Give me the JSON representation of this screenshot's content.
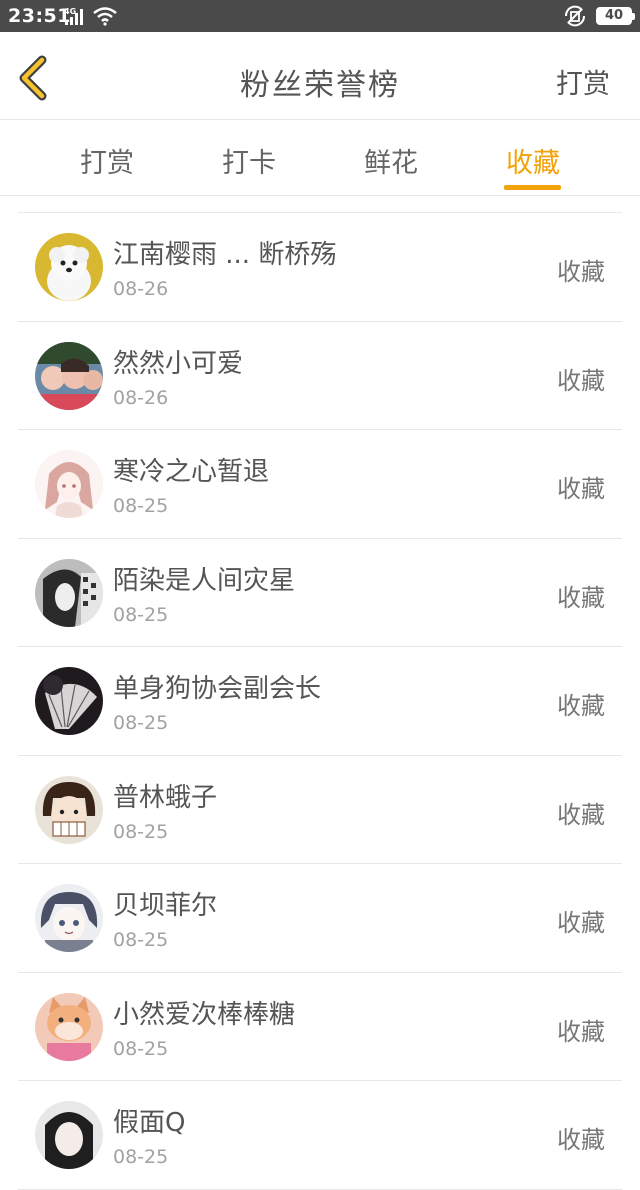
{
  "status_bar": {
    "time": "23:51",
    "network": "4G",
    "battery": "40"
  },
  "nav": {
    "title": "粉丝荣誉榜",
    "right_action": "打赏"
  },
  "tabs": [
    {
      "label": "打赏",
      "active": false
    },
    {
      "label": "打卡",
      "active": false
    },
    {
      "label": "鲜花",
      "active": false
    },
    {
      "label": "收藏",
      "active": true
    }
  ],
  "accent_color": "#f3a20a",
  "list": [
    {
      "name": "江南樱雨 ... 断桥殇",
      "date": "08-26",
      "action": "收藏",
      "avatar": "dog-avatar"
    },
    {
      "name": "然然小可爱",
      "date": "08-26",
      "action": "收藏",
      "avatar": "kids-avatar"
    },
    {
      "name": "寒冷之心暂退",
      "date": "08-25",
      "action": "收藏",
      "avatar": "anime-girl-sketch-avatar"
    },
    {
      "name": "陌染是人间灾星",
      "date": "08-25",
      "action": "收藏",
      "avatar": "manga-girl-avatar"
    },
    {
      "name": "单身狗协会副会长",
      "date": "08-25",
      "action": "收藏",
      "avatar": "fan-avatar"
    },
    {
      "name": "普林蛾子",
      "date": "08-25",
      "action": "收藏",
      "avatar": "cartoon-girl-avatar"
    },
    {
      "name": "贝坝菲尔",
      "date": "08-25",
      "action": "收藏",
      "avatar": "anime-boy-avatar"
    },
    {
      "name": "小然爱次棒棒糖",
      "date": "08-25",
      "action": "收藏",
      "avatar": "cat-avatar"
    },
    {
      "name": "假面Q",
      "date": "08-25",
      "action": "收藏",
      "avatar": "dark-hair-girl-avatar"
    }
  ]
}
